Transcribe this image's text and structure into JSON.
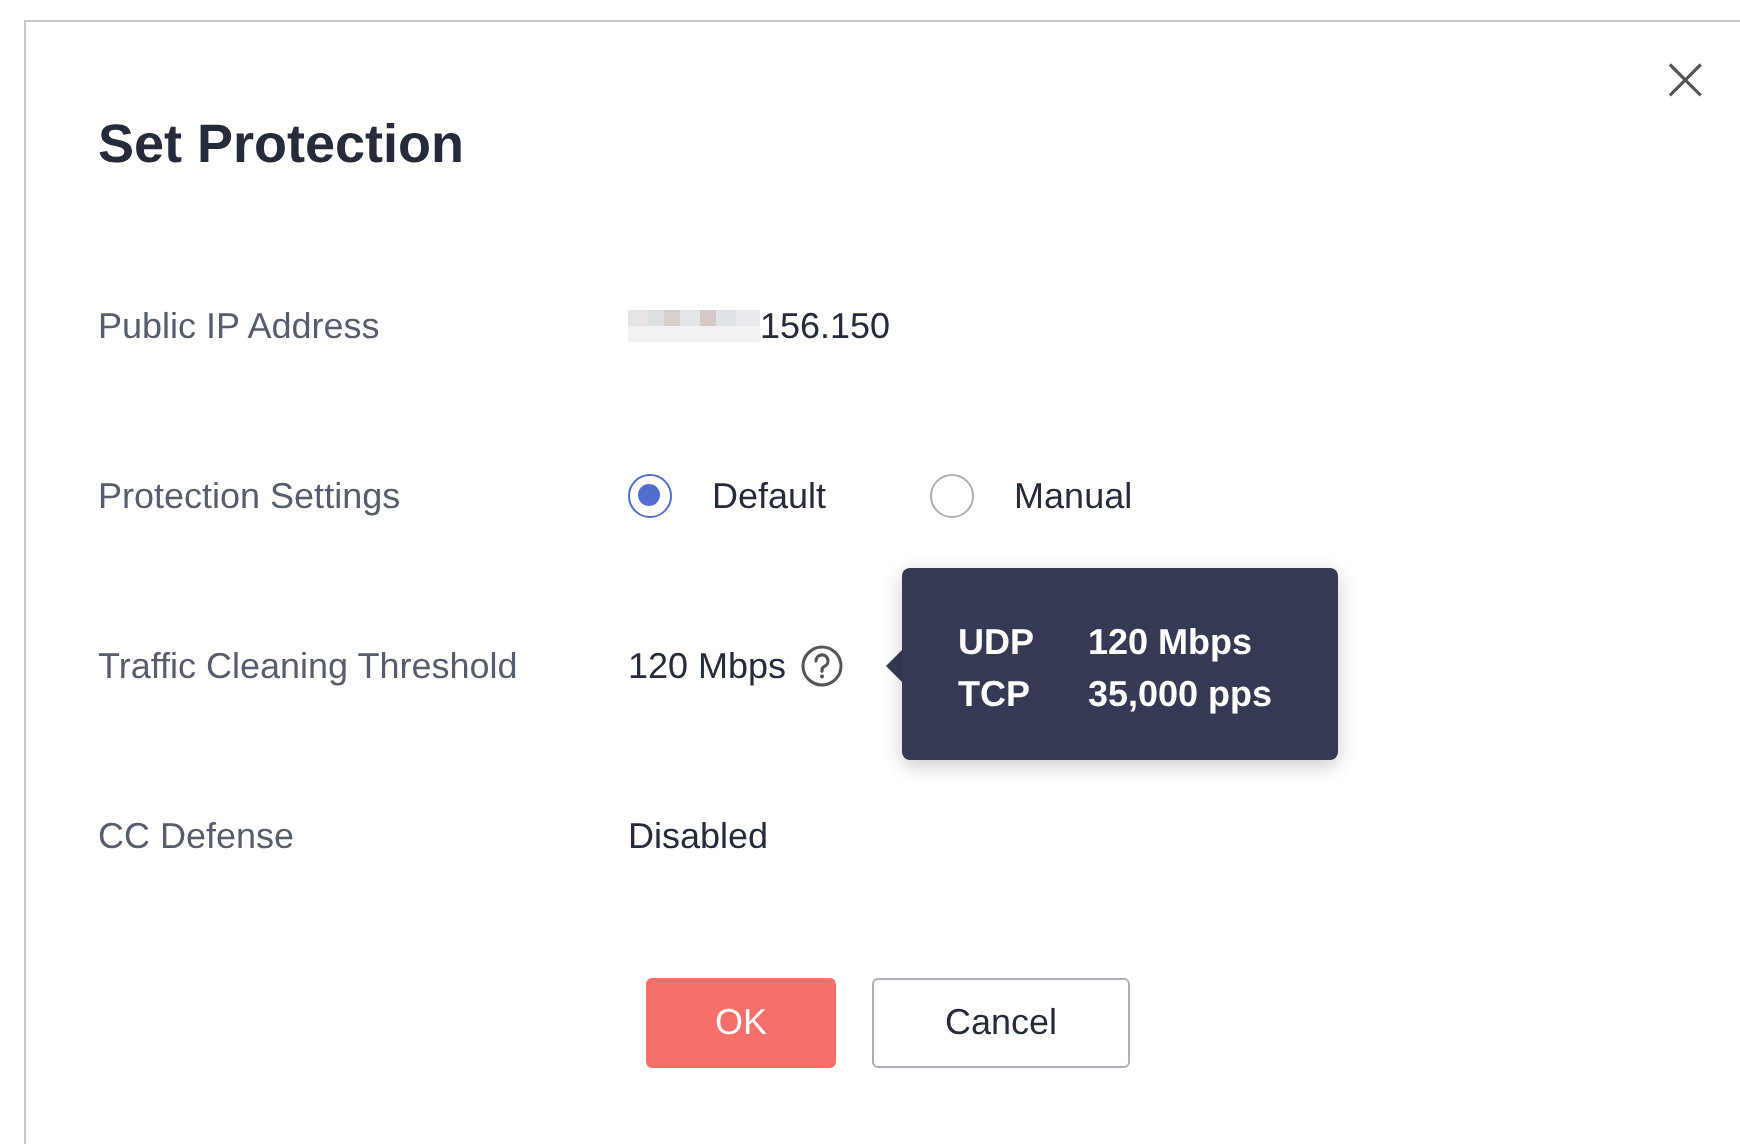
{
  "dialog": {
    "title": "Set Protection",
    "close": "×"
  },
  "fields": [
    {
      "kind": "ip",
      "label": "Public IP Address",
      "value": "156.150",
      "redacted": true
    },
    {
      "kind": "radio",
      "label": "Protection Settings",
      "options": [
        {
          "label": "Default",
          "selected": true
        },
        {
          "label": "Manual",
          "selected": false
        }
      ]
    },
    {
      "kind": "threshold",
      "label": "Traffic Cleaning Threshold",
      "value": "120 Mbps",
      "tooltip": {
        "rows": [
          {
            "protocol": "UDP",
            "limit": "120 Mbps"
          },
          {
            "protocol": "TCP",
            "limit": "35,000 pps"
          }
        ]
      }
    },
    {
      "kind": "text",
      "label": "CC Defense",
      "value": "Disabled"
    }
  ],
  "buttons": [
    {
      "label": "OK",
      "kind": "primary"
    },
    {
      "label": "Cancel",
      "kind": "secondary"
    }
  ]
}
